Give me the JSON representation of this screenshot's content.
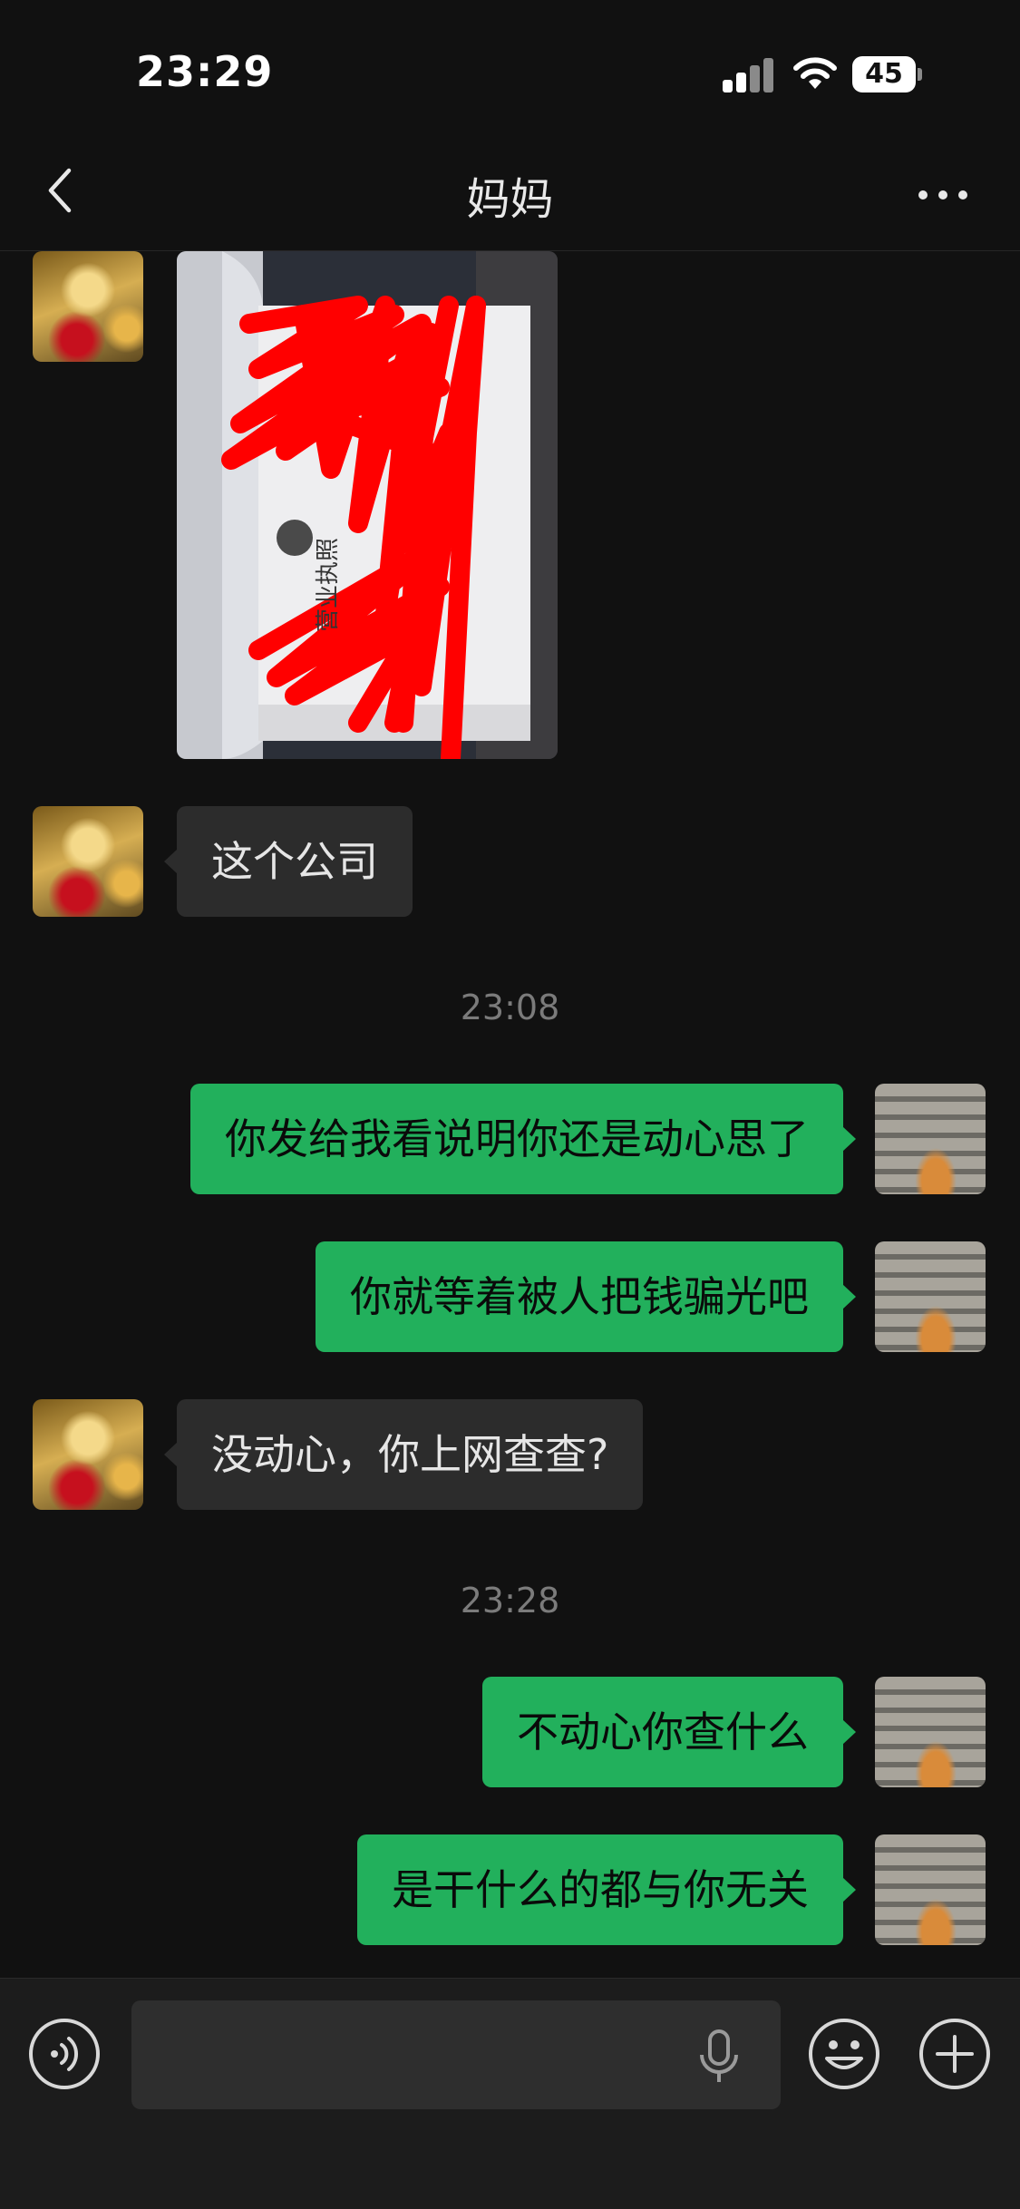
{
  "status_bar": {
    "time": "23:29",
    "battery": "45"
  },
  "header": {
    "title": "妈妈"
  },
  "image_message": {
    "visible_text": "营业执照"
  },
  "messages": [
    {
      "sender": "contact",
      "text": "这个公司"
    },
    {
      "sender": "me",
      "text": "你发给我看说明你还是动心思了"
    },
    {
      "sender": "me",
      "text": "你就等着被人把钱骗光吧"
    },
    {
      "sender": "contact",
      "text": "没动心，你上网查查?"
    },
    {
      "sender": "me",
      "text": "不动心你查什么"
    },
    {
      "sender": "me",
      "text": "是干什么的都与你无关"
    }
  ],
  "timestamps": [
    "23:08",
    "23:28"
  ],
  "input": {
    "value": "",
    "placeholder": ""
  },
  "icons": [
    "back-chevron-icon",
    "more-dots-icon",
    "voice-icon",
    "microphone-icon",
    "emoji-icon",
    "plus-icon"
  ],
  "colors": {
    "background": "#111111",
    "outgoing_bubble": "#22b05c",
    "incoming_bubble": "#2c2c2c",
    "redaction": "#ff0000"
  }
}
